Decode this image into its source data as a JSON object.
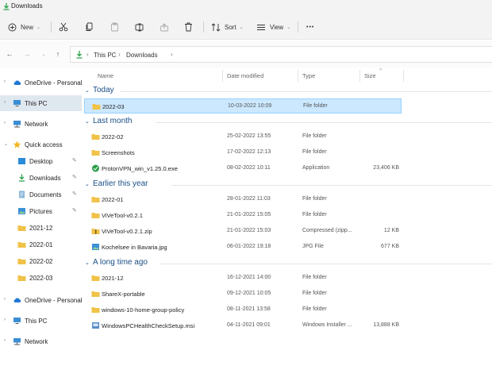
{
  "window": {
    "title": "Downloads"
  },
  "toolbar": {
    "new_label": "New",
    "sort_label": "Sort",
    "view_label": "View",
    "more_label": "•••"
  },
  "address": {
    "crumbs": [
      "This PC",
      "Downloads"
    ]
  },
  "sidebar": {
    "items": [
      {
        "label": "OneDrive - Personal"
      },
      {
        "label": "This PC"
      },
      {
        "label": "Network"
      },
      {
        "label": "Quick access"
      },
      {
        "label": "Desktop"
      },
      {
        "label": "Downloads"
      },
      {
        "label": "Documents"
      },
      {
        "label": "Pictures"
      },
      {
        "label": "2021-12"
      },
      {
        "label": "2022-01"
      },
      {
        "label": "2022-02"
      },
      {
        "label": "2022-03"
      },
      {
        "label": "OneDrive - Personal"
      },
      {
        "label": "This PC"
      },
      {
        "label": "Network"
      }
    ]
  },
  "columns": {
    "name": "Name",
    "date": "Date modified",
    "type": "Type",
    "size": "Size"
  },
  "groups": [
    {
      "label": "Today",
      "files": [
        {
          "name": "2022-03",
          "date": "10-03-2022 10:09",
          "type": "File folder",
          "size": "",
          "icon": "folder-icon"
        }
      ]
    },
    {
      "label": "Last month",
      "files": [
        {
          "name": "2022-02",
          "date": "25-02-2022 13:55",
          "type": "File folder",
          "size": "",
          "icon": "folder-icon"
        },
        {
          "name": "Screenshots",
          "date": "17-02-2022 12:13",
          "type": "File folder",
          "size": "",
          "icon": "folder-icon"
        },
        {
          "name": "ProtonVPN_win_v1.25.0.exe",
          "date": "08-02-2022 10:11",
          "type": "Application",
          "size": "23,406 KB",
          "icon": "app-icon"
        }
      ]
    },
    {
      "label": "Earlier this year",
      "files": [
        {
          "name": "2022-01",
          "date": "28-01-2022 11:03",
          "type": "File folder",
          "size": "",
          "icon": "folder-icon"
        },
        {
          "name": "ViVeTool-v0.2.1",
          "date": "21-01-2022 15:05",
          "type": "File folder",
          "size": "",
          "icon": "folder-icon"
        },
        {
          "name": "ViVeTool-v0.2.1.zip",
          "date": "21-01-2022 15:03",
          "type": "Compressed (zipp...",
          "size": "12 KB",
          "icon": "zip-icon"
        },
        {
          "name": "Kochelsee in Bavaria.jpg",
          "date": "06-01-2022 19:18",
          "type": "JPG File",
          "size": "677 KB",
          "icon": "image-icon"
        }
      ]
    },
    {
      "label": "A long time ago",
      "files": [
        {
          "name": "2021-12",
          "date": "16-12-2021 14:00",
          "type": "File folder",
          "size": "",
          "icon": "folder-icon"
        },
        {
          "name": "ShareX-portable",
          "date": "09-12-2021 10:05",
          "type": "File folder",
          "size": "",
          "icon": "folder-icon"
        },
        {
          "name": "windows-10-home-group-policy",
          "date": "08-11-2021 13:58",
          "type": "File folder",
          "size": "",
          "icon": "folder-icon"
        },
        {
          "name": "WindowsPCHealthCheckSetup.msi",
          "date": "04-11-2021 09:01",
          "type": "Windows Installer ...",
          "size": "13,888 KB",
          "icon": "installer-icon"
        }
      ]
    }
  ],
  "colors": {
    "folder": "#f0c248",
    "selection": "#cce8ff",
    "accent": "#1a4e85",
    "download_arrow": "#2aa24a"
  }
}
